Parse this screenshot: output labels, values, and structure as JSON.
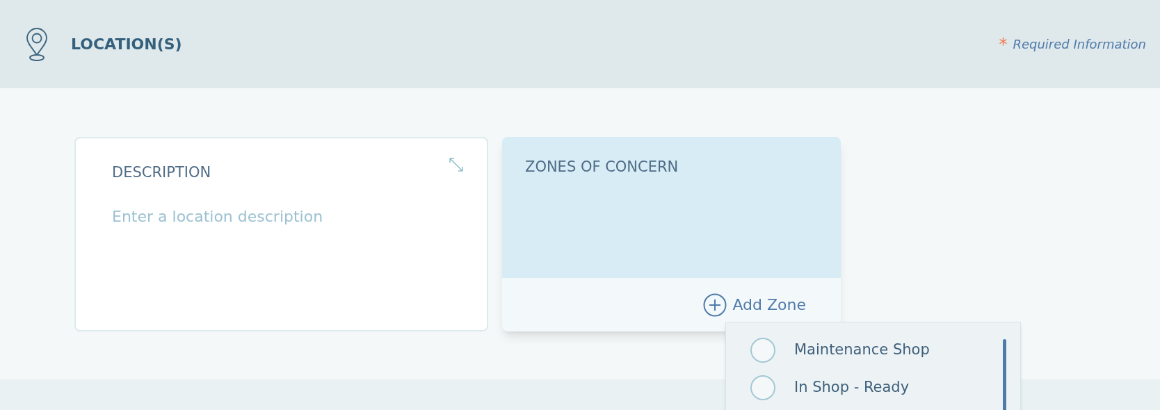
{
  "header": {
    "title": "LOCATION(S)",
    "required_mark": "*",
    "required_note": "Required Information"
  },
  "description": {
    "label": "DESCRIPTION",
    "placeholder": "Enter a location description"
  },
  "zones": {
    "title": "ZONES OF CONCERN",
    "add_button": "Add Zone"
  },
  "zone_menu": {
    "options": [
      {
        "label": "Maintenance Shop",
        "selected": false
      },
      {
        "label": "In Shop - Ready",
        "selected": false
      }
    ]
  }
}
